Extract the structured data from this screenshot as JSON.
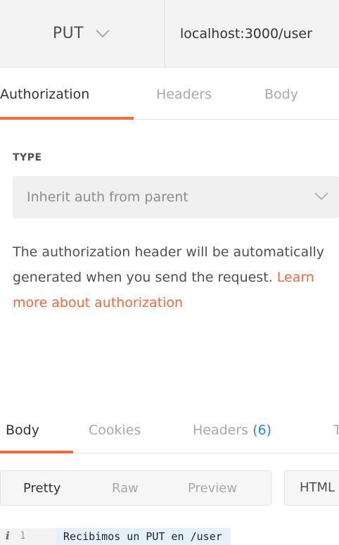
{
  "request": {
    "method": "PUT",
    "url": "localhost:3000/user"
  },
  "request_tabs": [
    {
      "label": "Authorization",
      "active": true
    },
    {
      "label": "Headers",
      "active": false
    },
    {
      "label": "Body",
      "active": false
    }
  ],
  "auth": {
    "type_label": "TYPE",
    "type_value": "Inherit auth from parent",
    "description": "The authorization header will be automatically generated when you send the request.",
    "learn_more": "Learn more about authorization"
  },
  "response_tabs": [
    {
      "label": "Body",
      "active": true
    },
    {
      "label": "Cookies",
      "active": false
    },
    {
      "label": "Headers",
      "count": "(6)",
      "active": false
    },
    {
      "label": "T",
      "active": false
    }
  ],
  "view_modes": [
    {
      "label": "Pretty",
      "active": true
    },
    {
      "label": "Raw",
      "active": false
    },
    {
      "label": "Preview",
      "active": false
    }
  ],
  "format": "HTML",
  "code": {
    "info_icon": "i",
    "line_number": "1",
    "line_text": "Recibimos un PUT en /user"
  },
  "colors": {
    "accent": "#f26b3a",
    "count": "#1e88e5",
    "panel_bg": "#f3f3f3"
  },
  "icons": {
    "method_dropdown": "chevron-down-icon",
    "auth_dropdown": "chevron-down-icon",
    "info": "info-icon"
  }
}
